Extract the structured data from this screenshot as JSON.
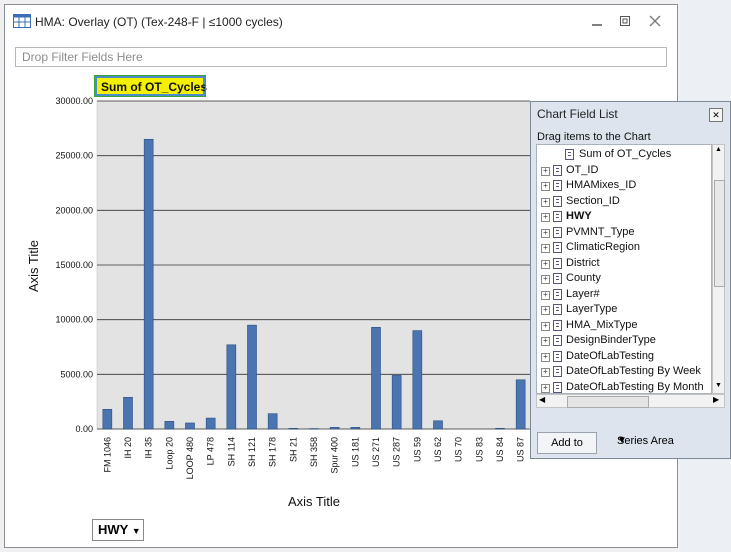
{
  "window": {
    "title": "HMA: Overlay (OT) (Tex-248-F | ≤1000 cycles)",
    "minimize_icon": "minimize-icon",
    "restore_icon": "restore-icon",
    "close_icon": "close-icon"
  },
  "filter_area": {
    "placeholder": "Drop Filter Fields Here"
  },
  "chart_field_label": "Sum of OT_Cycles",
  "category_field": {
    "label": "HWY",
    "icon": "dropdown-arrow-icon"
  },
  "chart_data": {
    "type": "bar",
    "title": "Sum of OT_Cycles",
    "xlabel": "Axis Title",
    "ylabel": "Axis Title",
    "ylim": [
      0,
      30000
    ],
    "yticks": [
      "0.00",
      "5000.00",
      "10000.00",
      "15000.00",
      "20000.00",
      "25000.00",
      "30000.00"
    ],
    "categories": [
      "FM 1046",
      "IH 20",
      "IH 35",
      "Loop 20",
      "LOOP 480",
      "LP 478",
      "SH 114",
      "SH 121",
      "SH 178",
      "SH 21",
      "SH 358",
      "Spur 400",
      "US 181",
      "US 271",
      "US 287",
      "US 59",
      "US 62",
      "US 70",
      "US 83",
      "US 84",
      "US 87"
    ],
    "values": [
      1800,
      2900,
      26500,
      700,
      550,
      1000,
      7700,
      9500,
      1400,
      60,
      40,
      150,
      150,
      9300,
      4900,
      9000,
      750,
      0,
      0,
      60,
      4500
    ],
    "bar_color": "#4a75b0",
    "grid": true
  },
  "field_list": {
    "title": "Chart Field List",
    "hint": "Drag items to the Chart",
    "items": [
      {
        "label": "Sum of OT_Cycles",
        "kind": "measure",
        "bold": false
      },
      {
        "label": "OT_ID",
        "kind": "field",
        "bold": false
      },
      {
        "label": "HMAMixes_ID",
        "kind": "field",
        "bold": false
      },
      {
        "label": "Section_ID",
        "kind": "field",
        "bold": false
      },
      {
        "label": "HWY",
        "kind": "field",
        "bold": true
      },
      {
        "label": "PVMNT_Type",
        "kind": "field",
        "bold": false
      },
      {
        "label": "ClimaticRegion",
        "kind": "field",
        "bold": false
      },
      {
        "label": "District",
        "kind": "field",
        "bold": false
      },
      {
        "label": "County",
        "kind": "field",
        "bold": false
      },
      {
        "label": "Layer#",
        "kind": "field",
        "bold": false
      },
      {
        "label": "LayerType",
        "kind": "field",
        "bold": false
      },
      {
        "label": "HMA_MixType",
        "kind": "field",
        "bold": false
      },
      {
        "label": "DesignBinderType",
        "kind": "field",
        "bold": false
      },
      {
        "label": "DateOfLabTesting",
        "kind": "field",
        "bold": false
      },
      {
        "label": "DateOfLabTesting By Week",
        "kind": "field",
        "bold": false
      },
      {
        "label": "DateOfLabTesting By Month",
        "kind": "field",
        "bold": false
      }
    ],
    "add_button": "Add to",
    "area_select": "Series Area"
  }
}
